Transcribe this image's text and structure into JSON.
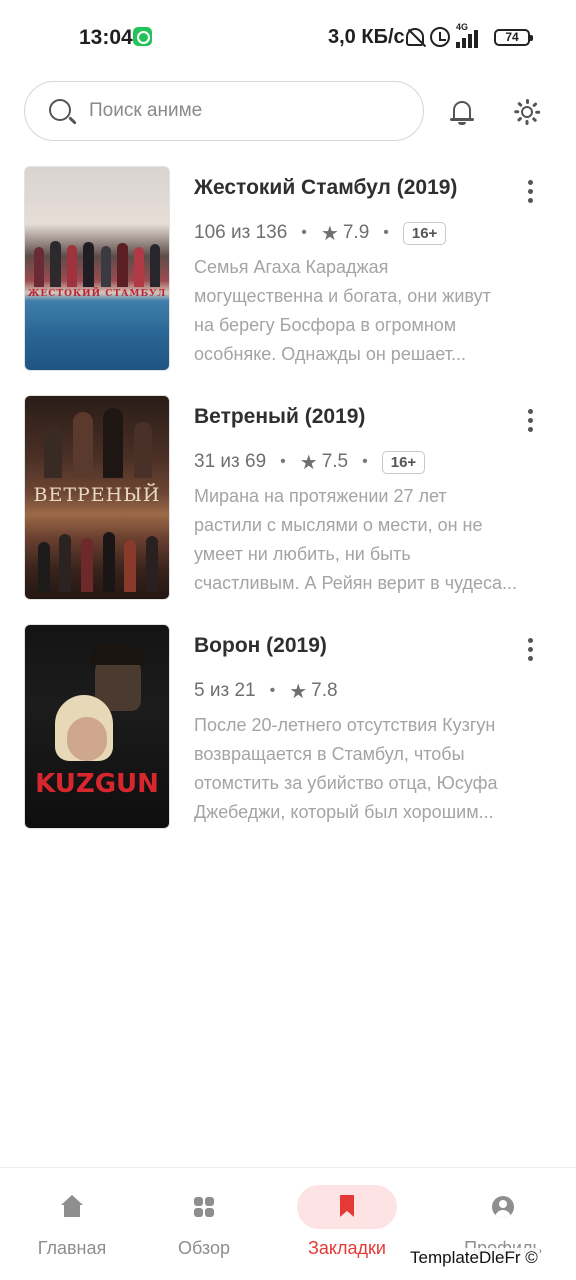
{
  "status_bar": {
    "time": "13:04",
    "network_speed": "3,0 КБ/с",
    "network_type": "4G",
    "battery": "74"
  },
  "search": {
    "placeholder": "Поиск аниме"
  },
  "header": {
    "notifications_icon": "bell-icon",
    "theme_icon": "sun-icon"
  },
  "bookmarks": [
    {
      "title": "Жестокий Стамбул (2019)",
      "episodes": "106 из 136",
      "rating": "7.9",
      "age": "16+",
      "description": "Семья Агаха Караджая\nмогущественна и богата, они живут\nна берегу Босфора в огромном\nособняке. Однажды он решает...",
      "poster_text": "ЖЕСТОКИЙ СТАМБУЛ"
    },
    {
      "title": "Ветреный (2019)",
      "episodes": "31 из 69",
      "rating": "7.5",
      "age": "16+",
      "description": "Мирана на протяжении 27 лет\nрастили с мыслями о мести, он не\nумеет ни любить, ни быть\nсчастливым. А Рейян верит в чудеса...",
      "poster_text": "ВЕТРЕНЫЙ"
    },
    {
      "title": "Ворон (2019)",
      "episodes": "5 из 21",
      "rating": "7.8",
      "age": "",
      "description": "После 20-летнего отсутствия Кузгун\nвозвращается в Стамбул, чтобы\nотомстить за убийство отца, Юсуфа\nДжебеджи, который был хорошим...",
      "poster_text": "KUZGUN"
    }
  ],
  "bottom_nav": [
    {
      "label": "Главная",
      "icon": "home-icon",
      "active": false
    },
    {
      "label": "Обзор",
      "icon": "grid-icon",
      "active": false
    },
    {
      "label": "Закладки",
      "icon": "bookmark-icon",
      "active": true
    },
    {
      "label": "Профиль",
      "icon": "profile-icon",
      "active": false
    }
  ],
  "watermark": "TemplateDleFr ©",
  "colors": {
    "accent": "#e53935",
    "accent_soft": "#fde3e3",
    "text_primary": "#2f2f2f",
    "text_secondary": "#6f6f6f",
    "text_muted": "#a4a4a4"
  }
}
